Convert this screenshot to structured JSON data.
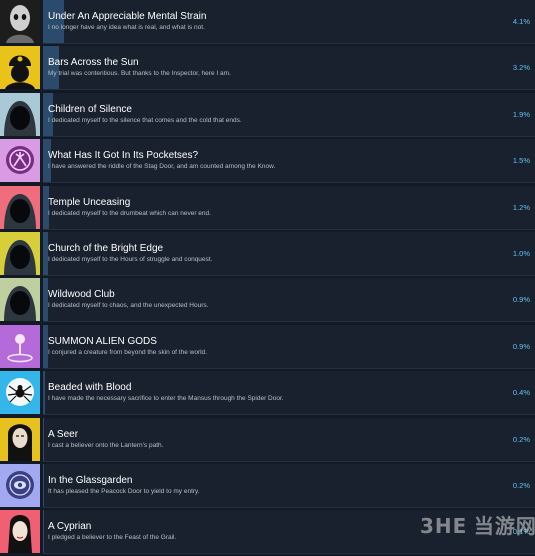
{
  "achievements": [
    {
      "title": "Under An Appreciable Mental Strain",
      "description": "I no longer have any idea what is real, and what is not.",
      "percent_label": "4.1%",
      "percent": 4.1,
      "icon": "pale-face-icon",
      "icon_bg": "#1d1d1d"
    },
    {
      "title": "Bars Across the Sun",
      "description": "My trial was contentious. But thanks to the Inspector, here I am.",
      "percent_label": "3.2%",
      "percent": 3.2,
      "icon": "constable-icon",
      "icon_bg": "#e9c21a"
    },
    {
      "title": "Children of Silence",
      "description": "I dedicated myself to the silence that comes and the cold that ends.",
      "percent_label": "1.9%",
      "percent": 1.9,
      "icon": "hooded-figure-icon",
      "icon_bg": "#a9c9d6"
    },
    {
      "title": "What Has It Got In Its Pocketses?",
      "description": "I have answered the riddle of the Stag Door, and am counted among the Know.",
      "percent_label": "1.5%",
      "percent": 1.5,
      "icon": "stag-door-sigil-icon",
      "icon_bg": "#d99be3"
    },
    {
      "title": "Temple Unceasing",
      "description": "I dedicated myself to the drumbeat which can never end.",
      "percent_label": "1.2%",
      "percent": 1.2,
      "icon": "hooded-figure-icon",
      "icon_bg": "#f06d7e"
    },
    {
      "title": "Church of the Bright Edge",
      "description": "I dedicated myself to the Hours of struggle and conquest.",
      "percent_label": "1.0%",
      "percent": 1.0,
      "icon": "hooded-figure-icon",
      "icon_bg": "#d7cf3a"
    },
    {
      "title": "Wildwood Club",
      "description": "I dedicated myself to chaos, and the unexpected Hours.",
      "percent_label": "0.9%",
      "percent": 0.9,
      "icon": "hooded-figure-icon",
      "icon_bg": "#c0cfa0"
    },
    {
      "title": "SUMMON ALIEN GODS",
      "description": "I conjured a creature from beyond the skin of the world.",
      "percent_label": "0.9%",
      "percent": 0.9,
      "icon": "summoning-icon",
      "icon_bg": "#b46bd9"
    },
    {
      "title": "Beaded with Blood",
      "description": "I have made the necessary sacrifice to enter the Mansus through the Spider Door.",
      "percent_label": "0.4%",
      "percent": 0.4,
      "icon": "spider-icon",
      "icon_bg": "#33b7ea"
    },
    {
      "title": "A Seer",
      "description": "I cast a believer onto the Lantern's path.",
      "percent_label": "0.2%",
      "percent": 0.2,
      "icon": "seer-portrait-icon",
      "icon_bg": "#e7c11e"
    },
    {
      "title": "In the Glassgarden",
      "description": "It has pleased the Peacock Door to yield to my entry.",
      "percent_label": "0.2%",
      "percent": 0.2,
      "icon": "peacock-door-icon",
      "icon_bg": "#a3a9f0"
    },
    {
      "title": "A Cyprian",
      "description": "I pledged a believer to the Feast of the Grail.",
      "percent_label": "0.1%",
      "percent": 0.1,
      "icon": "cyprian-portrait-icon",
      "icon_bg": "#f05f72"
    }
  ],
  "colors": {
    "page_bg": "#121a25",
    "panel_bg": "#18212d",
    "progress_bar": "#2c4a6b",
    "title_text": "#ffffff",
    "description_text": "#b9bfc6",
    "percent_text": "#66c0f4"
  },
  "watermark": {
    "logo": "3HE",
    "text": "当游网"
  }
}
